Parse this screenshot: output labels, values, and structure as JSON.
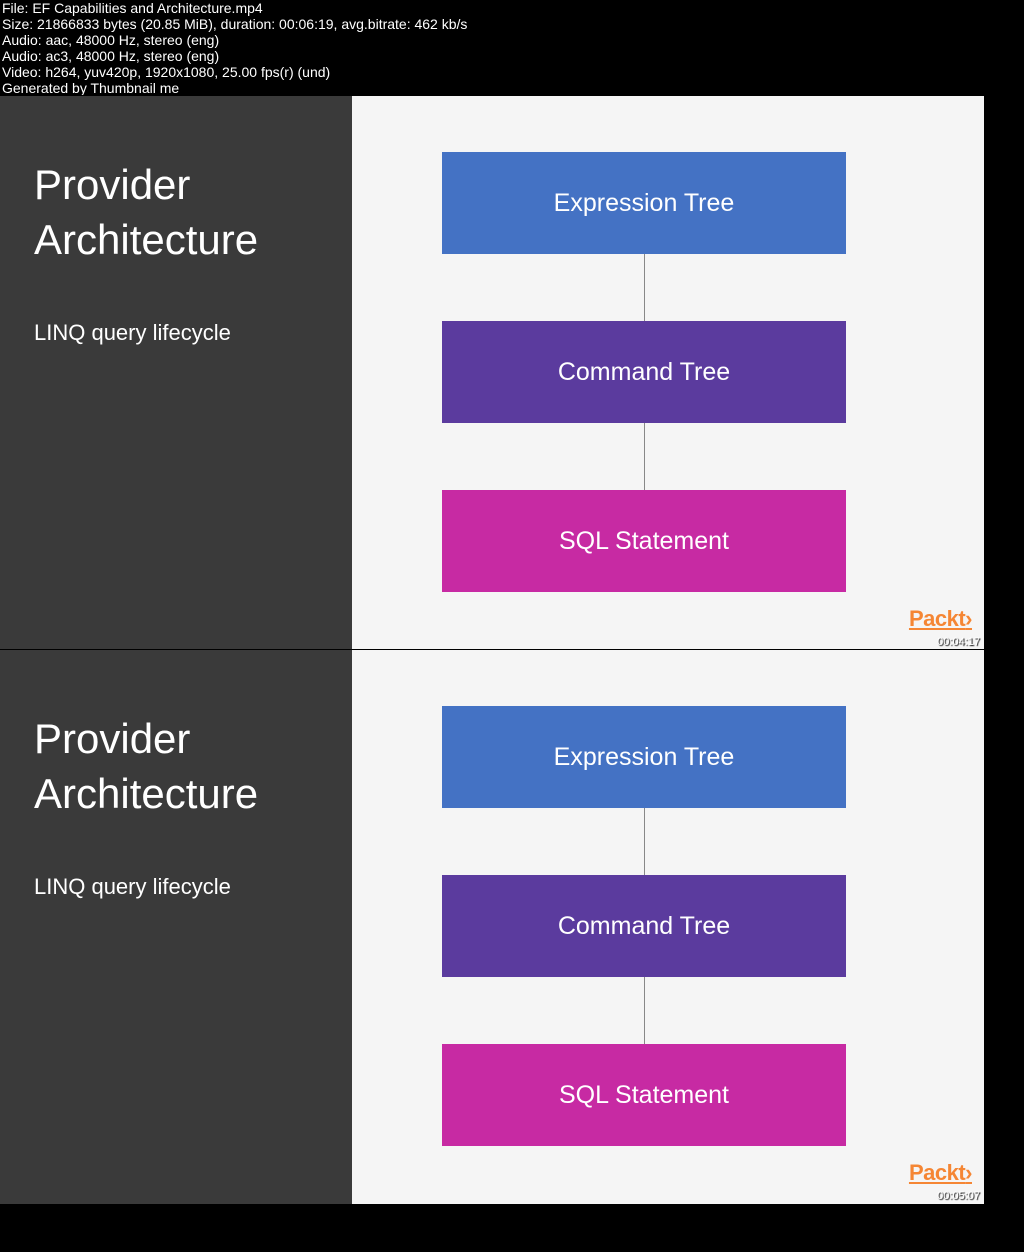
{
  "metadata": {
    "file_line": "File: EF Capabilities and Architecture.mp4",
    "size_line": "Size: 21866833 bytes (20.85 MiB), duration: 00:06:19, avg.bitrate: 462 kb/s",
    "audio1_line": "Audio: aac, 48000 Hz, stereo (eng)",
    "audio2_line": "Audio: ac3, 48000 Hz, stereo (eng)",
    "video_line": "Video: h264, yuv420p, 1920x1080, 25.00 fps(r) (und)",
    "generated_line": "Generated by Thumbnail me"
  },
  "sidebar": {
    "title": "Provider Architecture",
    "subtitle": "LINQ query lifecycle"
  },
  "flow": {
    "box1": "Expression Tree",
    "box2": "Command Tree",
    "box3": "SQL Statement"
  },
  "brand": {
    "logo_text": "Packt",
    "logo_arrow": "›"
  },
  "timestamps": {
    "thumb1": "00:04:17",
    "thumb2": "00:05:07"
  }
}
